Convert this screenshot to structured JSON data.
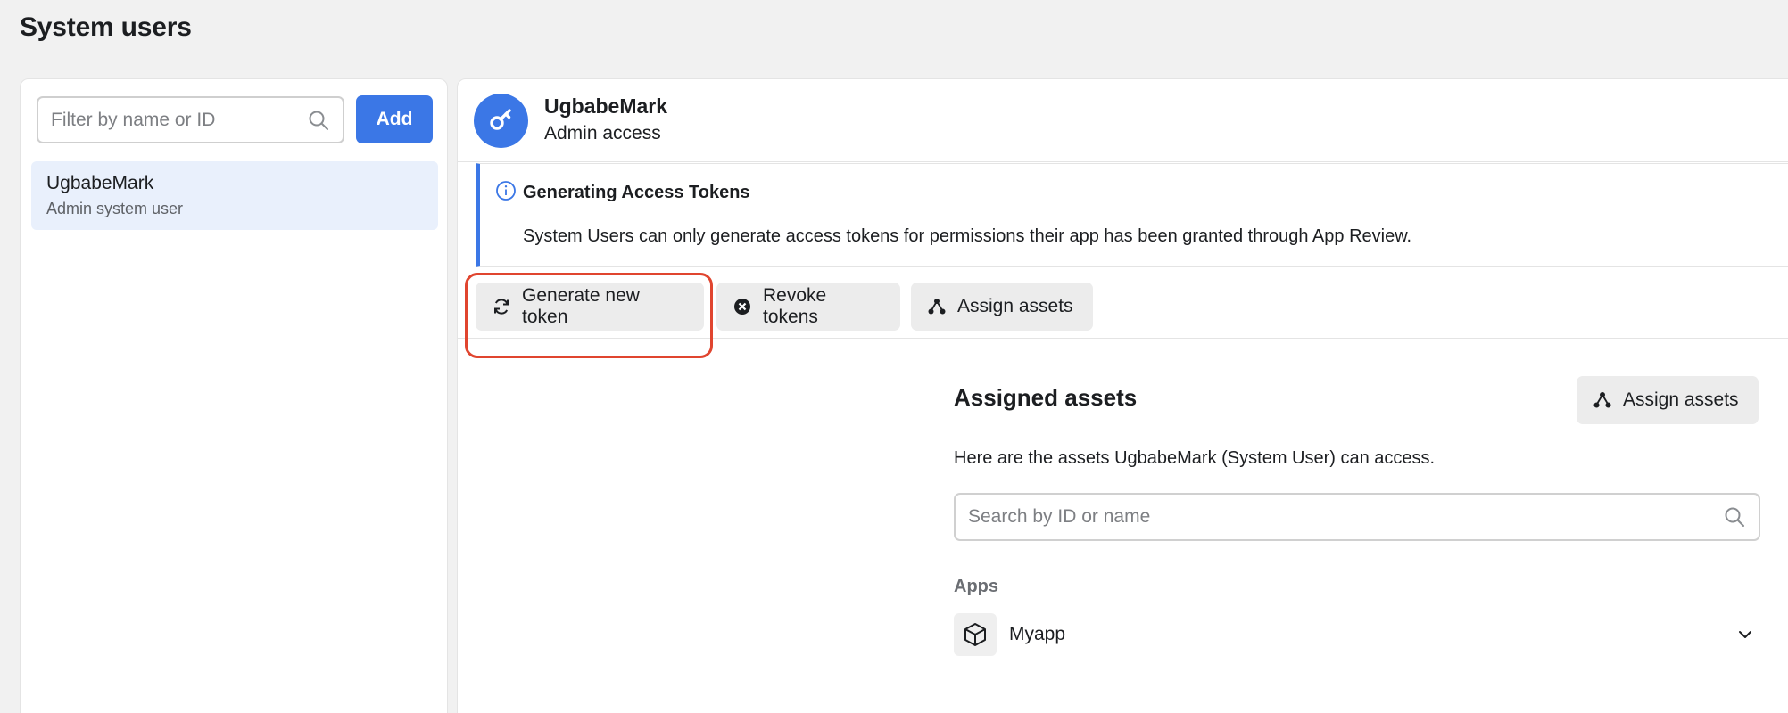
{
  "page": {
    "title": "System users"
  },
  "sidebar": {
    "filter_placeholder": "Filter by name or ID",
    "add_label": "Add",
    "users": [
      {
        "name": "UgbabeMark",
        "subtitle": "Admin system user",
        "selected": true
      }
    ]
  },
  "detail": {
    "name": "UgbabeMark",
    "role": "Admin access",
    "banner": {
      "title": "Generating Access Tokens",
      "text": "System Users can only generate access tokens for permissions their app has been granted through App Review."
    },
    "toolbar": {
      "generate_label": "Generate new token",
      "revoke_label": "Revoke tokens",
      "assign_label": "Assign assets"
    },
    "assets": {
      "title": "Assigned assets",
      "assign_label": "Assign assets",
      "description": "Here are the assets UgbabeMark (System User) can access.",
      "search_placeholder": "Search by ID or name",
      "apps_label": "Apps",
      "apps": [
        {
          "name": "Myapp"
        }
      ]
    }
  },
  "colors": {
    "accent": "#3b77e6",
    "highlight": "#e0452f",
    "selected_bg": "#e9f0fc",
    "button_bg": "#ececec"
  },
  "icons": {
    "search": "search-icon",
    "key": "key-icon",
    "info": "info-icon",
    "refresh": "refresh-icon",
    "revoke": "x-circle-icon",
    "assign": "assign-nodes-icon",
    "app": "cube-icon",
    "expand": "chevron-down-icon"
  }
}
